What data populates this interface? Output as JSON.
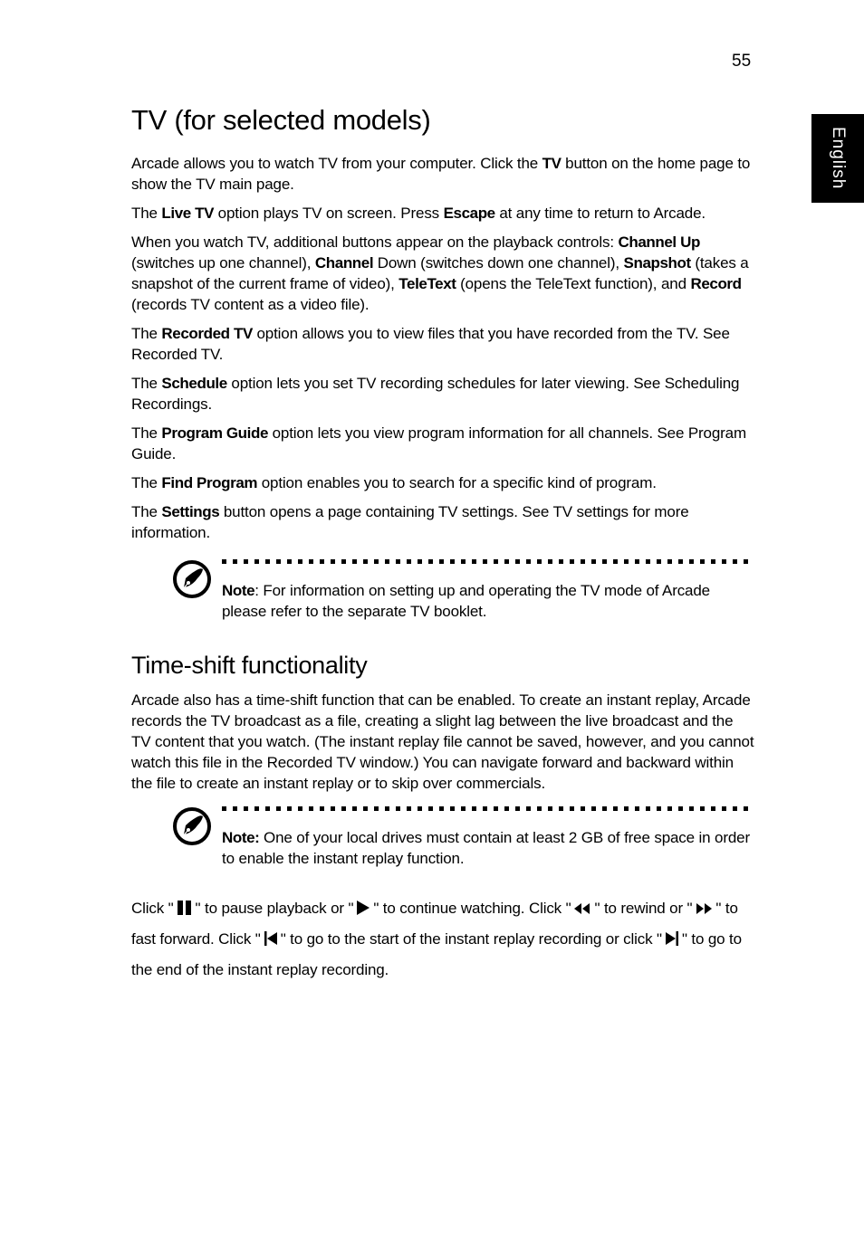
{
  "page_number": "55",
  "language_tab": "English",
  "section1": {
    "title": "TV (for selected models)",
    "paragraphs": {
      "p1": {
        "a": "Arcade allows you to watch TV from your computer. Click the ",
        "b1": "TV",
        "c": " button on the home page to show the TV main page."
      },
      "p2": {
        "a": "The ",
        "b1": "Live TV",
        "c": " option plays TV on screen. Press ",
        "b2": "Escape",
        "d": " at any time to return to Arcade."
      },
      "p3": {
        "a": "When you watch TV, additional buttons appear on the playback controls: ",
        "b1": "Channel Up",
        "c": " (switches up one channel), ",
        "b2": "Channel",
        "d": " Down (switches down one channel), ",
        "b3": "Snapshot",
        "e": " (takes a snapshot of the current frame of video), ",
        "b4": "TeleText",
        "f": " (opens the TeleText function), and ",
        "b5": "Record",
        "g": " (records TV content as a video file)."
      },
      "p4": {
        "a": "The ",
        "b1": "Recorded TV",
        "c": " option allows you to view files that you have recorded from the TV. See Recorded TV."
      },
      "p5": {
        "a": "The ",
        "b1": "Schedule",
        "c": " option lets you set TV recording schedules for later viewing. See Scheduling Recordings."
      },
      "p6": {
        "a": "The ",
        "b1": "Program Guide",
        "c": " option lets you view program information for all channels. See Program Guide."
      },
      "p7": {
        "a": "The ",
        "b1": "Find Program",
        "c": " option enables you to search for a specific kind of program."
      },
      "p8": {
        "a": "The ",
        "b1": "Settings",
        "c": " button opens a page containing TV settings. See TV settings for more information."
      }
    },
    "note": {
      "label": "Note",
      "text": ": For information on setting up and operating the TV mode of Arcade please refer to the separate TV booklet."
    }
  },
  "section2": {
    "title": "Time-shift functionality",
    "body": "Arcade also has a time-shift function that can be enabled. To create an instant replay, Arcade records the TV broadcast as a file, creating a slight lag between the live broadcast and the TV content that you watch. (The instant replay file cannot be saved, however, and you cannot watch this file in the Recorded TV window.) You can navigate forward and backward within the file to create an instant replay or to skip over commercials.",
    "note": {
      "label": "Note:",
      "text": " One of your local drives must contain at least 2 GB of free space in order to enable the instant replay function."
    },
    "controls": {
      "t1": "Click \"",
      "t2": "\" to pause playback or \"",
      "t3": "\" to continue watching. Click \"",
      "t4": "\" to rewind or \"",
      "t5": "\" to fast forward. Click \"",
      "t6": "\" to go to the start of the instant replay recording or click \"",
      "t7": "\" to go to the end of the instant replay recording."
    }
  },
  "icons": {
    "note": "note-pen-icon",
    "pause": "pause-icon",
    "play": "play-icon",
    "rewind": "rewind-icon",
    "fast_forward": "fast-forward-icon",
    "skip_start": "skip-to-start-icon",
    "skip_end": "skip-to-end-icon"
  }
}
